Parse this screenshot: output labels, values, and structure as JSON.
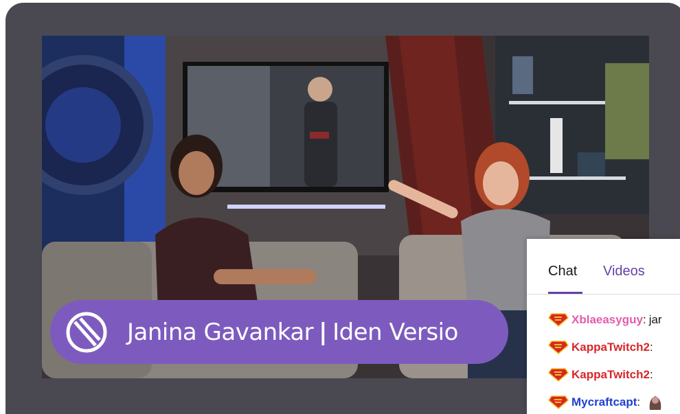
{
  "stream": {
    "lower_third": {
      "name": "Janina Gavankar",
      "separator": "|",
      "role": "Iden Versio",
      "icon": "empire-crest-icon"
    }
  },
  "chat": {
    "tabs": [
      {
        "label": "Chat",
        "active": true
      },
      {
        "label": "Videos",
        "active": false
      }
    ],
    "accent_color": "#6441a4",
    "messages": [
      {
        "user": "Xblaeasyguy",
        "color": "#e45cae",
        "text": "jar",
        "badge": "superman-badge-icon"
      },
      {
        "user": "KappaTwitch2",
        "color": "#d8262a",
        "text": "",
        "badge": "superman-badge-icon"
      },
      {
        "user": "KappaTwitch2",
        "color": "#d8262a",
        "text": "",
        "badge": "superman-badge-icon"
      },
      {
        "user": "Mycraftcapt",
        "color": "#1f3fd1",
        "text": "",
        "badge": "superman-badge-icon"
      }
    ]
  }
}
